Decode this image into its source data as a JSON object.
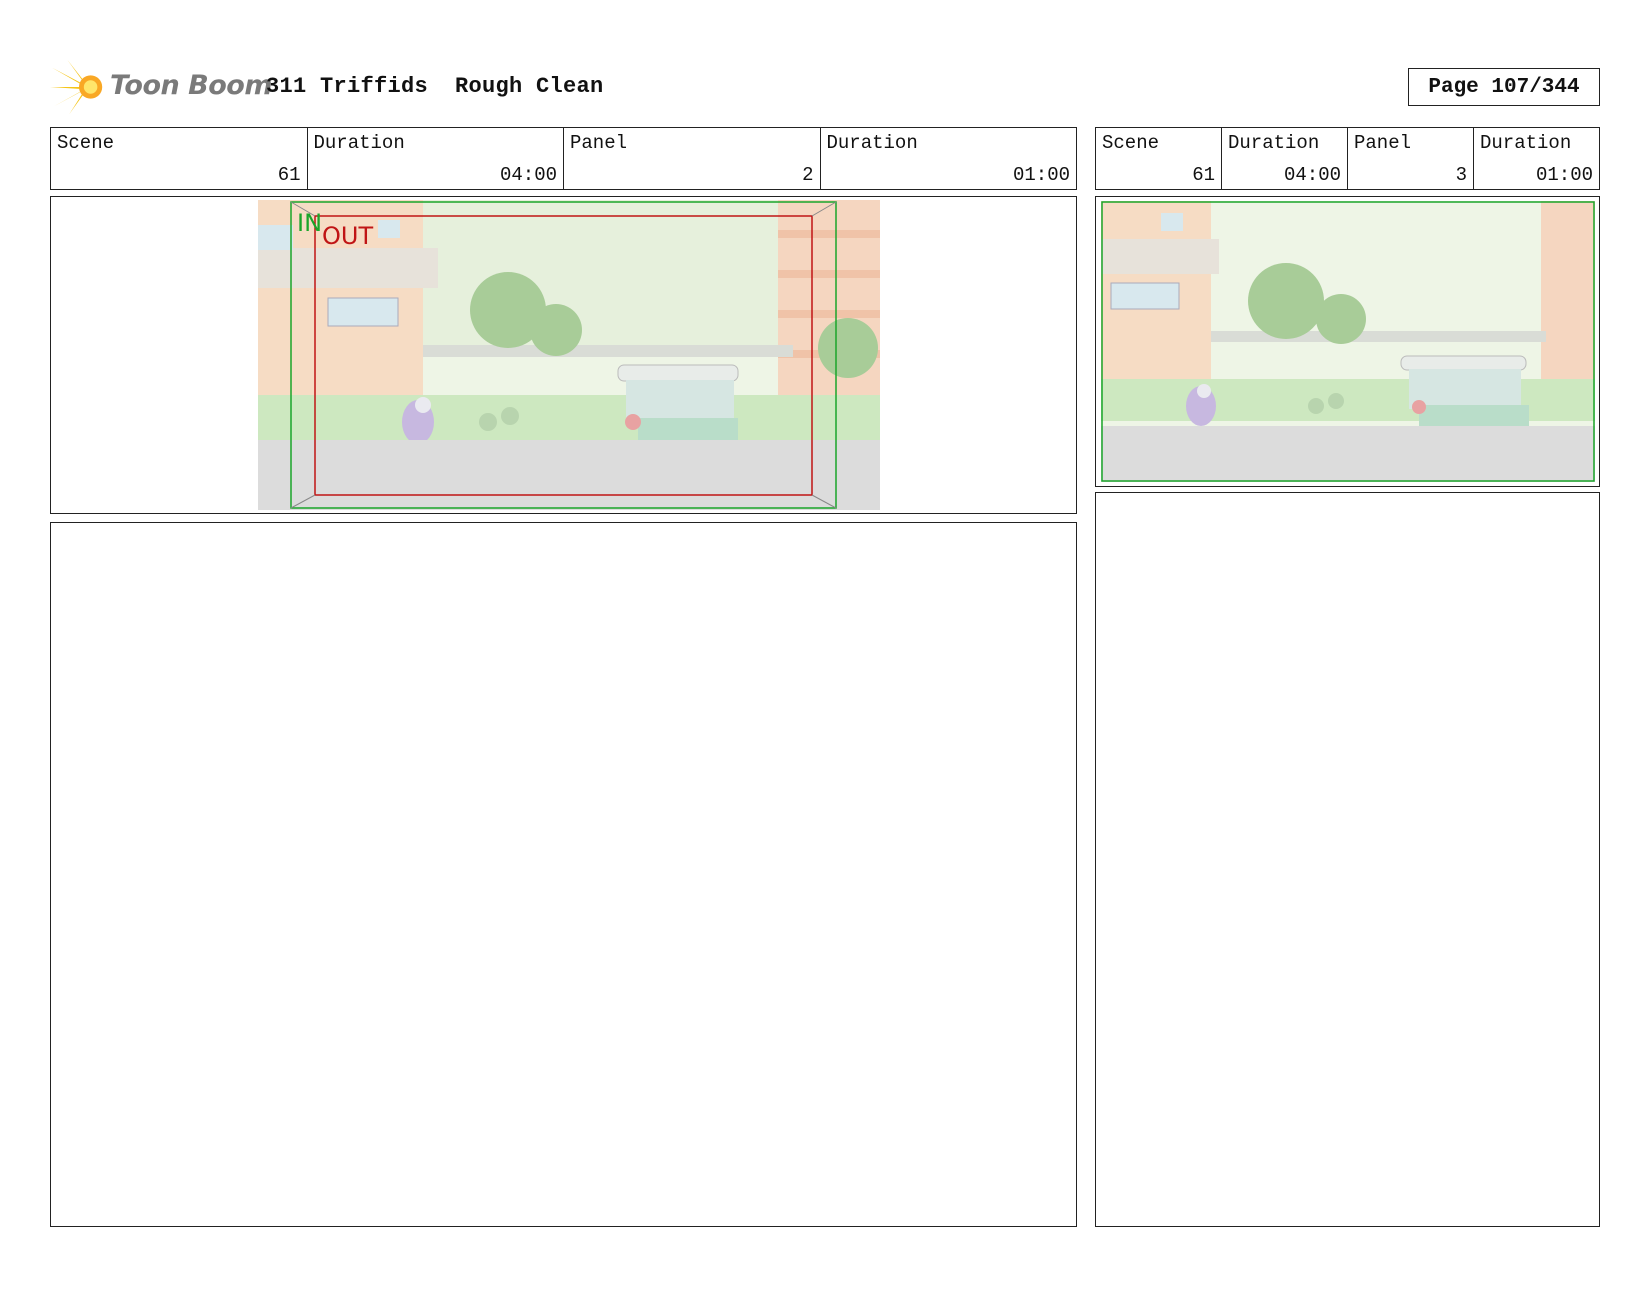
{
  "header": {
    "logo_text": "Toon Boom",
    "title": "311 Triffids  Rough Clean",
    "page": "Page 107/344"
  },
  "left_panel": {
    "scene_label": "Scene",
    "scene_value": "61",
    "duration_label": "Duration",
    "duration_value": "04:00",
    "panel_label": "Panel",
    "panel_value": "2",
    "panel_duration_label": "Duration",
    "panel_duration_value": "01:00",
    "camera_in": "IN",
    "camera_out": "OUT"
  },
  "right_panel": {
    "scene_label": "Scene",
    "scene_value": "61",
    "duration_label": "Duration",
    "duration_value": "04:00",
    "panel_label": "Panel",
    "panel_value": "3",
    "panel_duration_label": "Duration",
    "panel_duration_value": "01:00"
  },
  "colors": {
    "camera_in": "#1aa52a",
    "camera_out": "#c01515",
    "logo_burst": "#f5c518"
  }
}
